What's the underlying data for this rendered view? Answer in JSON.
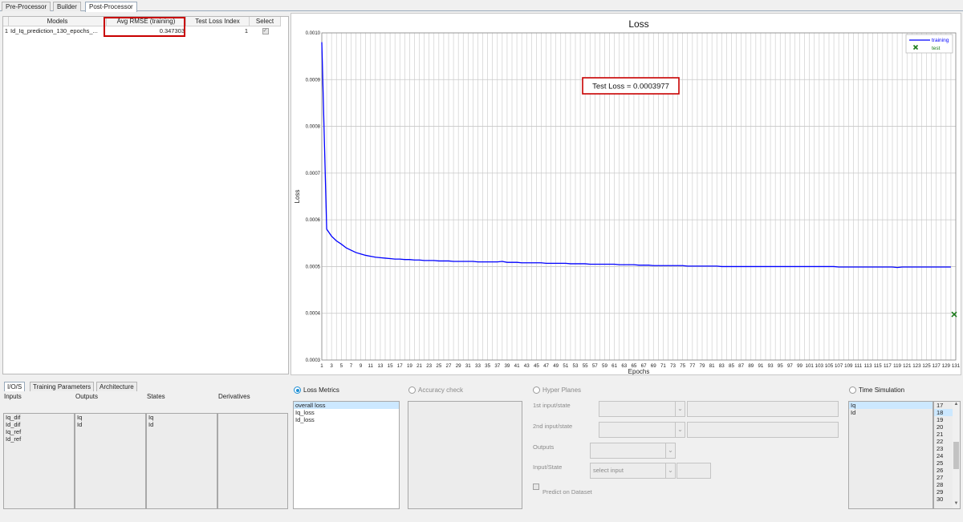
{
  "top_tabs": [
    "Pre-Processor",
    "Builder",
    "Post-Processor"
  ],
  "models_table": {
    "headers": [
      "Models",
      "Avg RMSE (training)",
      "Test Loss Index",
      "Select"
    ],
    "rows": [
      {
        "index": "1",
        "model": "Id_Iq_prediction_130_epochs_...",
        "rmse": "0.347303",
        "test_loss_index": "1",
        "selected": true
      }
    ]
  },
  "chart_data": {
    "type": "line",
    "title": "Loss",
    "xlabel": "Epochs",
    "ylabel": "Loss",
    "xlim": [
      1,
      131
    ],
    "ylim": [
      0.0003,
      0.001
    ],
    "y_ticks": [
      "0.0003",
      "0.0004",
      "0.0005",
      "0.0006",
      "0.0007",
      "0.0008",
      "0.0009",
      "0.0010"
    ],
    "x_ticks": [
      "1",
      "3",
      "5",
      "7",
      "9",
      "11",
      "13",
      "15",
      "17",
      "19",
      "21",
      "23",
      "25",
      "27",
      "29",
      "31",
      "33",
      "35",
      "37",
      "39",
      "41",
      "43",
      "45",
      "47",
      "49",
      "51",
      "53",
      "55",
      "57",
      "59",
      "61",
      "63",
      "65",
      "67",
      "69",
      "71",
      "73",
      "75",
      "77",
      "79",
      "81",
      "83",
      "85",
      "87",
      "89",
      "91",
      "93",
      "95",
      "97",
      "99",
      "101",
      "103",
      "105",
      "107",
      "109",
      "111",
      "113",
      "115",
      "117",
      "119",
      "121",
      "123",
      "125",
      "127",
      "129",
      "131"
    ],
    "grid": true,
    "legend_placement": "top-right",
    "annotation": "Test Loss = 0.0003977",
    "series": [
      {
        "name": "training",
        "color": "#0000ff",
        "x": [
          1,
          2,
          3,
          4,
          5,
          6,
          7,
          8,
          9,
          10,
          11,
          12,
          13,
          14,
          15,
          16,
          17,
          18,
          19,
          20,
          21,
          22,
          23,
          24,
          25,
          26,
          27,
          28,
          29,
          30,
          31,
          32,
          33,
          34,
          35,
          36,
          37,
          38,
          39,
          40,
          41,
          42,
          43,
          44,
          45,
          46,
          47,
          48,
          49,
          50,
          51,
          52,
          53,
          54,
          55,
          56,
          57,
          58,
          59,
          60,
          61,
          62,
          63,
          64,
          65,
          66,
          67,
          68,
          69,
          70,
          71,
          72,
          73,
          74,
          75,
          76,
          77,
          78,
          79,
          80,
          81,
          82,
          83,
          84,
          85,
          86,
          87,
          88,
          89,
          90,
          91,
          92,
          93,
          94,
          95,
          96,
          97,
          98,
          99,
          100,
          101,
          102,
          103,
          104,
          105,
          106,
          107,
          108,
          109,
          110,
          111,
          112,
          113,
          114,
          115,
          116,
          117,
          118,
          119,
          120,
          121,
          122,
          123,
          124,
          125,
          126,
          127,
          128,
          129,
          130
        ],
        "y": [
          0.00098,
          0.00058,
          0.000565,
          0.000555,
          0.000548,
          0.00054,
          0.000535,
          0.00053,
          0.000527,
          0.000524,
          0.000522,
          0.00052,
          0.000519,
          0.000518,
          0.000517,
          0.000516,
          0.000516,
          0.000515,
          0.000515,
          0.000514,
          0.000514,
          0.000513,
          0.000513,
          0.000513,
          0.000512,
          0.000512,
          0.000512,
          0.000511,
          0.000511,
          0.000511,
          0.000511,
          0.000511,
          0.00051,
          0.00051,
          0.00051,
          0.00051,
          0.00051,
          0.000511,
          0.000509,
          0.000509,
          0.000509,
          0.000508,
          0.000508,
          0.000508,
          0.000508,
          0.000508,
          0.000507,
          0.000507,
          0.000507,
          0.000507,
          0.000507,
          0.000506,
          0.000506,
          0.000506,
          0.000506,
          0.000505,
          0.000505,
          0.000505,
          0.000505,
          0.000505,
          0.000505,
          0.000504,
          0.000504,
          0.000504,
          0.000504,
          0.000503,
          0.000503,
          0.000503,
          0.000502,
          0.000502,
          0.000502,
          0.000502,
          0.000502,
          0.000502,
          0.000502,
          0.000501,
          0.000501,
          0.000501,
          0.000501,
          0.000501,
          0.000501,
          0.000501,
          0.0005,
          0.0005,
          0.0005,
          0.0005,
          0.0005,
          0.0005,
          0.0005,
          0.0005,
          0.0005,
          0.0005,
          0.0005,
          0.0005,
          0.0005,
          0.0005,
          0.0005,
          0.0005,
          0.0005,
          0.0005,
          0.0005,
          0.0005,
          0.0005,
          0.0005,
          0.0005,
          0.0005,
          0.000499,
          0.000499,
          0.000499,
          0.000499,
          0.000499,
          0.000499,
          0.000499,
          0.000499,
          0.000499,
          0.000499,
          0.000499,
          0.000499,
          0.000498,
          0.000499,
          0.000499,
          0.000499,
          0.000499,
          0.000499,
          0.000499,
          0.000499,
          0.000499,
          0.000499,
          0.000499,
          0.000499
        ]
      },
      {
        "name": "test",
        "color": "#1a7a1a",
        "x": [
          131
        ],
        "y": [
          0.0003977
        ]
      }
    ]
  },
  "bottom_tabs": [
    "I/O/S",
    "Training Parameters",
    "Architecture"
  ],
  "ios": {
    "headers": [
      "Inputs",
      "Outputs",
      "States",
      "Derivatives"
    ],
    "inputs": [
      "Iq_dif",
      "Id_dif",
      "Iq_ref",
      "Id_ref"
    ],
    "outputs": [
      "Iq",
      "Id"
    ],
    "states": [
      "Iq",
      "Id"
    ],
    "derivatives": []
  },
  "loss_metrics": {
    "label": "Loss Metrics",
    "items": [
      "overall loss",
      "Iq_loss",
      "Id_loss"
    ]
  },
  "accuracy_check": {
    "label": "Accuracy check"
  },
  "hyper_planes": {
    "label": "Hyper Planes",
    "first_input_label": "1st input/state",
    "second_input_label": "2nd input/state",
    "outputs_label": "Outputs",
    "input_state_label": "Input/State",
    "select_input_placeholder": "select input",
    "predict_label": "Predict on Dataset"
  },
  "time_simulation": {
    "label": "Time Simulation",
    "signals": [
      "Iq",
      "Id"
    ],
    "numbers": [
      "17",
      "18",
      "19",
      "20",
      "21",
      "22",
      "23",
      "24",
      "25",
      "26",
      "27",
      "28",
      "29",
      "30"
    ]
  }
}
